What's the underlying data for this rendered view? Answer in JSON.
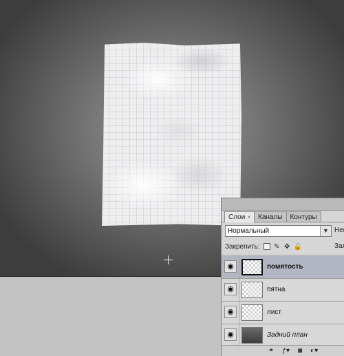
{
  "layers_panel": {
    "tabs": [
      {
        "label": "Слои",
        "close": "×"
      },
      {
        "label": "Каналы"
      },
      {
        "label": "Контуры"
      }
    ],
    "blend_mode": "Нормальный",
    "opacity_label": "Непрозр.:",
    "lock_label": "Закрепить:",
    "fill_label": "Заливка:",
    "layers": [
      {
        "name": "помятость",
        "selected": true
      },
      {
        "name": "пятна"
      },
      {
        "name": "лист"
      },
      {
        "name": "Задний план",
        "italic": true
      }
    ]
  },
  "icons": {
    "eye": "eye-icon",
    "select_arrow": "chevron-down-icon",
    "lock_transparency": "checkerboard-lock-icon",
    "lock_image": "brush-lock-icon",
    "lock_position": "move-lock-icon",
    "lock_all": "padlock-icon",
    "link": "link-icon",
    "styles": "fx-icon",
    "mask": "mask-icon",
    "adjustment": "adjustment-icon"
  }
}
